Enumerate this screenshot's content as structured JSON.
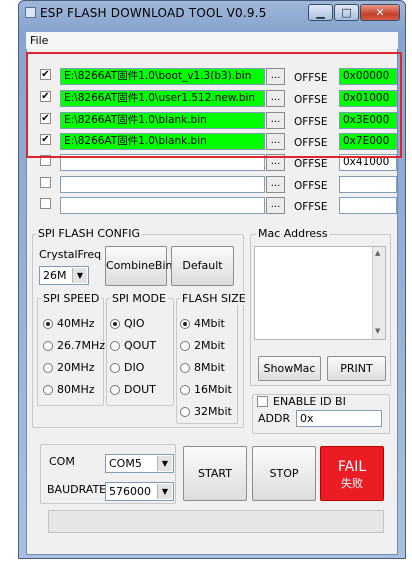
{
  "window": {
    "title": "ESP FLASH DOWNLOAD TOOL V0.9.5",
    "min_glyph": "▁",
    "max_glyph": "□",
    "close_glyph": "✕"
  },
  "menu": {
    "file": "File"
  },
  "rows": [
    {
      "checked": true,
      "path": "E:\\8266AT固件1.0\\boot_v1.3(b3).bin",
      "offset_label": "OFFSE",
      "address": "0x00000",
      "highlight": true
    },
    {
      "checked": true,
      "path": "E:\\8266AT固件1.0\\user1.512.new.bin",
      "offset_label": "OFFSE",
      "address": "0x01000",
      "highlight": true
    },
    {
      "checked": true,
      "path": "E:\\8266AT固件1.0\\blank.bin",
      "offset_label": "OFFSE",
      "address": "0x3E000",
      "highlight": true
    },
    {
      "checked": true,
      "path": "E:\\8266AT固件1.0\\blank.bin",
      "offset_label": "OFFSE",
      "address": "0x7E000",
      "highlight": true
    },
    {
      "checked": false,
      "path": "",
      "offset_label": "OFFSE",
      "address": "0x41000",
      "highlight": false
    },
    {
      "checked": false,
      "path": "",
      "offset_label": "OFFSE",
      "address": "",
      "highlight": false
    },
    {
      "checked": false,
      "path": "",
      "offset_label": "OFFSE",
      "address": "",
      "highlight": false
    }
  ],
  "browse_label": "...",
  "check_mark": "✔",
  "spi": {
    "group_label": "SPI FLASH CONFIG",
    "crystal_label": "CrystalFreq",
    "crystal_value": "26M",
    "combine_label": "CombineBin",
    "default_label": "Default",
    "speed": {
      "label": "SPI SPEED",
      "options": [
        "40MHz",
        "26.7MHz",
        "20MHz",
        "80MHz"
      ],
      "selected": "40MHz"
    },
    "mode": {
      "label": "SPI MODE",
      "options": [
        "QIO",
        "QOUT",
        "DIO",
        "DOUT"
      ],
      "selected": "QIO"
    },
    "size": {
      "label": "FLASH SIZE",
      "options": [
        "4Mbit",
        "2Mbit",
        "8Mbit",
        "16Mbit",
        "32Mbit"
      ],
      "selected": "4Mbit"
    }
  },
  "mac": {
    "group_label": "Mac Address",
    "showmac_label": "ShowMac",
    "print_label": "PRINT"
  },
  "idbind": {
    "label": "ENABLE ID BI",
    "addr_label": "ADDR",
    "addr_value": "0x"
  },
  "com": {
    "label": "COM",
    "value": "COM5"
  },
  "baud": {
    "label": "BAUDRATE",
    "value": "576000"
  },
  "buttons": {
    "start": "START",
    "stop": "STOP",
    "fail": "FAIL",
    "fail_sub": "失败"
  },
  "colors": {
    "accent_green": "#00ff00",
    "highlight_red": "#e0262c",
    "fail_red": "#ec1c24"
  }
}
